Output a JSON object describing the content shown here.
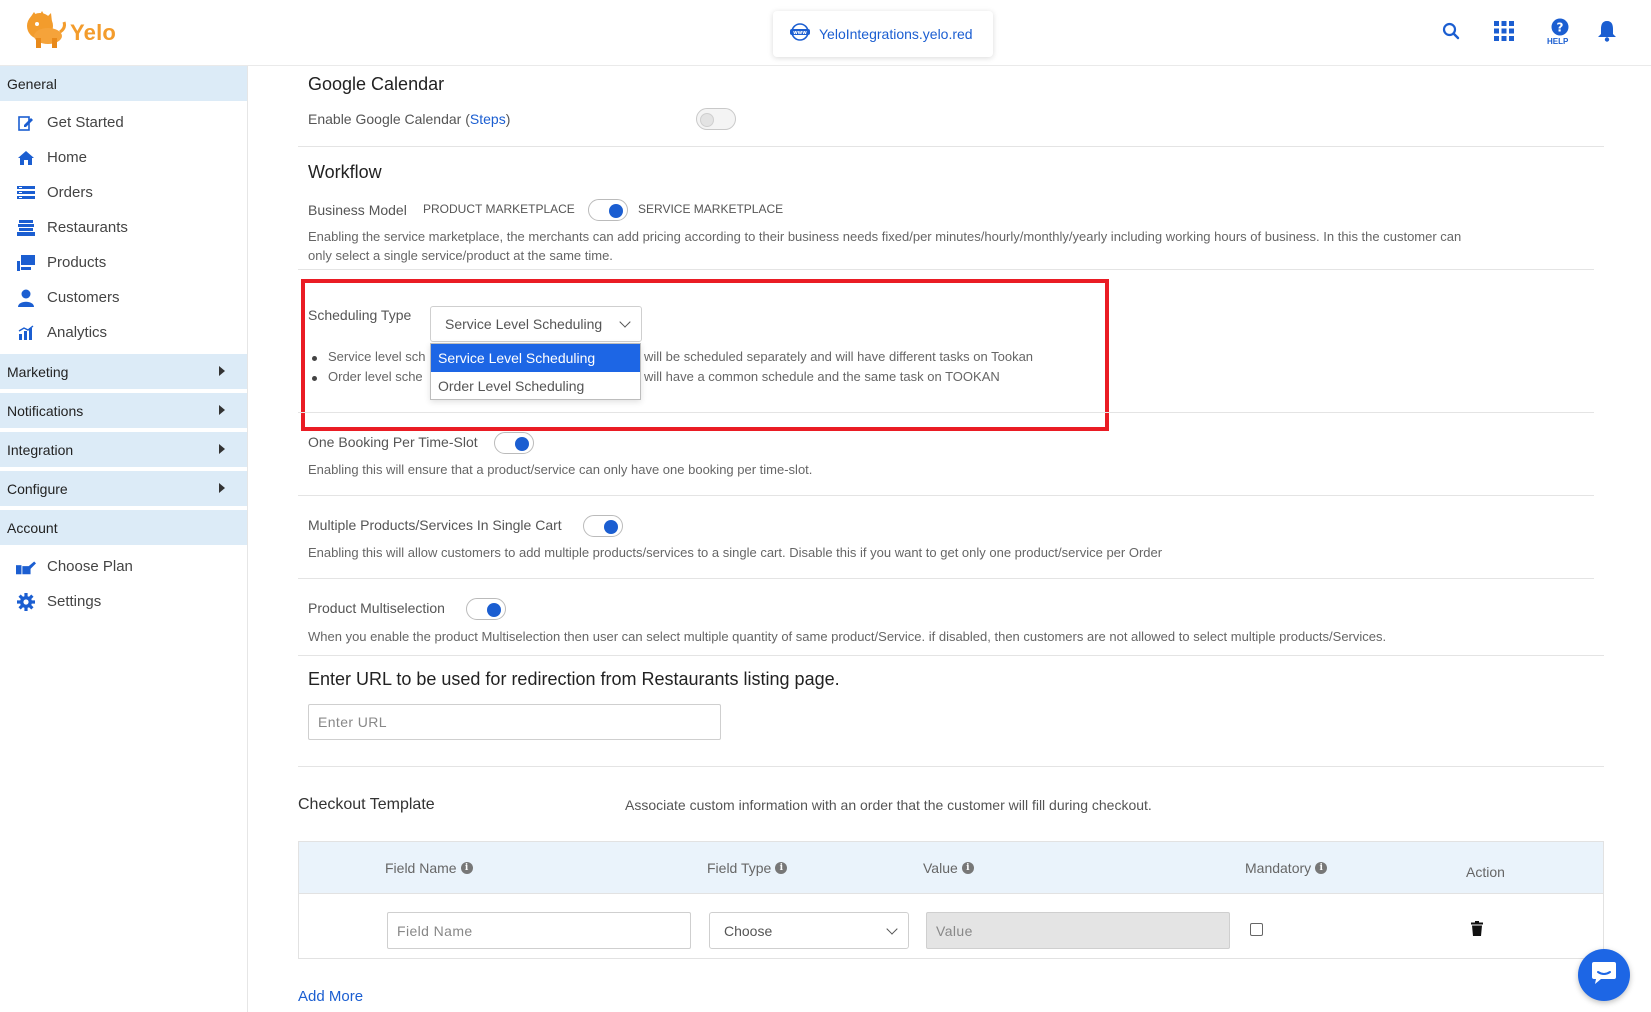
{
  "header": {
    "logo_text": "Yelo",
    "domain": "YeloIntegrations.yelo.red",
    "help_label": "HELP",
    "icons": [
      "search-icon",
      "apps-grid-icon",
      "help-icon",
      "bell-icon"
    ]
  },
  "sidebar": {
    "general": "General",
    "general_items": [
      {
        "label": "Get Started",
        "icon": "edit-icon"
      },
      {
        "label": "Home",
        "icon": "home-icon"
      },
      {
        "label": "Orders",
        "icon": "orders-icon"
      },
      {
        "label": "Restaurants",
        "icon": "store-icon"
      },
      {
        "label": "Products",
        "icon": "products-icon"
      },
      {
        "label": "Customers",
        "icon": "user-icon"
      },
      {
        "label": "Analytics",
        "icon": "analytics-icon"
      }
    ],
    "marketing": "Marketing",
    "notifications": "Notifications",
    "integration": "Integration",
    "configure": "Configure",
    "account": "Account",
    "account_items": [
      {
        "label": "Choose Plan",
        "icon": "plan-icon"
      },
      {
        "label": "Settings",
        "icon": "gear-icon"
      }
    ]
  },
  "google_calendar": {
    "title": "Google Calendar",
    "label_prefix": "Enable Google Calendar (",
    "steps_link": "Steps",
    "label_suffix": ")",
    "enabled": false
  },
  "workflow": {
    "title": "Workflow",
    "business_model_label": "Business Model",
    "left_option": "PRODUCT MARKETPLACE",
    "right_option": "SERVICE MARKETPLACE",
    "description_line1": "Enabling the service marketplace, the merchants can add pricing according to their business needs fixed/per minutes/hourly/monthly/yearly including working hours of business. In this the customer can",
    "description_line2": "only select a single service/product at the same time."
  },
  "scheduling": {
    "label": "Scheduling Type",
    "selected": "Service Level Scheduling",
    "options": [
      "Service Level Scheduling",
      "Order Level Scheduling"
    ],
    "bullet1_start": "Service level sch",
    "bullet1_end": "will be scheduled separately and will have different tasks on Tookan",
    "bullet2_start": "Order level sche",
    "bullet2_end": "will have a common schedule and the same task on TOOKAN"
  },
  "one_booking": {
    "label": "One Booking Per Time-Slot",
    "description": "Enabling this will ensure that a product/service can only have one booking per time-slot."
  },
  "multi_cart": {
    "label": "Multiple Products/Services In Single Cart",
    "description": "Enabling this will allow customers to add multiple products/services to a single cart. Disable this if you want to get only one product/service per Order"
  },
  "multiselection": {
    "label": "Product Multiselection",
    "description": "When you enable the product Multiselection then user can select multiple quantity of same product/Service. if disabled, then customers are not allowed to select multiple products/Services."
  },
  "redirect": {
    "title": "Enter URL to be used for redirection from Restaurants listing page.",
    "placeholder": "Enter URL"
  },
  "checkout": {
    "title": "Checkout Template",
    "description": "Associate custom information with an order that the customer will fill during checkout.",
    "columns": [
      "Field Name",
      "Field Type",
      "Value",
      "Mandatory",
      "Action"
    ],
    "field_name_placeholder": "Field Name",
    "field_type_selected": "Choose",
    "value_placeholder": "Value",
    "add_more": "Add More"
  },
  "colors": {
    "accent": "#1b5ed1",
    "brand": "#f39c2c",
    "highlight_border": "#ea1c24",
    "sidebar_section_bg": "#dcebf7"
  }
}
